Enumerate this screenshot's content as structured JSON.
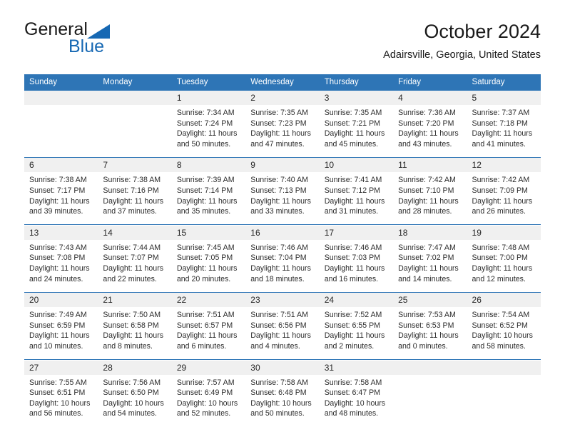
{
  "brand": {
    "name_part1": "General",
    "name_part2": "Blue",
    "triangle_color": "#1668b3",
    "blue_text_color": "#1668b3"
  },
  "header": {
    "title": "October 2024",
    "subtitle": "Adairsville, Georgia, United States"
  },
  "theme": {
    "header_blue": "#2e75b6",
    "daynum_band": "#f0f0f0",
    "text": "#2b2b2b"
  },
  "weekday_headers": [
    "Sunday",
    "Monday",
    "Tuesday",
    "Wednesday",
    "Thursday",
    "Friday",
    "Saturday"
  ],
  "weeks": [
    {
      "days": [
        {
          "num": "",
          "sunrise": "",
          "sunset": "",
          "daylight_line1": "",
          "daylight_line2": ""
        },
        {
          "num": "",
          "sunrise": "",
          "sunset": "",
          "daylight_line1": "",
          "daylight_line2": ""
        },
        {
          "num": "1",
          "sunrise": "Sunrise: 7:34 AM",
          "sunset": "Sunset: 7:24 PM",
          "daylight_line1": "Daylight: 11 hours",
          "daylight_line2": "and 50 minutes."
        },
        {
          "num": "2",
          "sunrise": "Sunrise: 7:35 AM",
          "sunset": "Sunset: 7:23 PM",
          "daylight_line1": "Daylight: 11 hours",
          "daylight_line2": "and 47 minutes."
        },
        {
          "num": "3",
          "sunrise": "Sunrise: 7:35 AM",
          "sunset": "Sunset: 7:21 PM",
          "daylight_line1": "Daylight: 11 hours",
          "daylight_line2": "and 45 minutes."
        },
        {
          "num": "4",
          "sunrise": "Sunrise: 7:36 AM",
          "sunset": "Sunset: 7:20 PM",
          "daylight_line1": "Daylight: 11 hours",
          "daylight_line2": "and 43 minutes."
        },
        {
          "num": "5",
          "sunrise": "Sunrise: 7:37 AM",
          "sunset": "Sunset: 7:18 PM",
          "daylight_line1": "Daylight: 11 hours",
          "daylight_line2": "and 41 minutes."
        }
      ]
    },
    {
      "days": [
        {
          "num": "6",
          "sunrise": "Sunrise: 7:38 AM",
          "sunset": "Sunset: 7:17 PM",
          "daylight_line1": "Daylight: 11 hours",
          "daylight_line2": "and 39 minutes."
        },
        {
          "num": "7",
          "sunrise": "Sunrise: 7:38 AM",
          "sunset": "Sunset: 7:16 PM",
          "daylight_line1": "Daylight: 11 hours",
          "daylight_line2": "and 37 minutes."
        },
        {
          "num": "8",
          "sunrise": "Sunrise: 7:39 AM",
          "sunset": "Sunset: 7:14 PM",
          "daylight_line1": "Daylight: 11 hours",
          "daylight_line2": "and 35 minutes."
        },
        {
          "num": "9",
          "sunrise": "Sunrise: 7:40 AM",
          "sunset": "Sunset: 7:13 PM",
          "daylight_line1": "Daylight: 11 hours",
          "daylight_line2": "and 33 minutes."
        },
        {
          "num": "10",
          "sunrise": "Sunrise: 7:41 AM",
          "sunset": "Sunset: 7:12 PM",
          "daylight_line1": "Daylight: 11 hours",
          "daylight_line2": "and 31 minutes."
        },
        {
          "num": "11",
          "sunrise": "Sunrise: 7:42 AM",
          "sunset": "Sunset: 7:10 PM",
          "daylight_line1": "Daylight: 11 hours",
          "daylight_line2": "and 28 minutes."
        },
        {
          "num": "12",
          "sunrise": "Sunrise: 7:42 AM",
          "sunset": "Sunset: 7:09 PM",
          "daylight_line1": "Daylight: 11 hours",
          "daylight_line2": "and 26 minutes."
        }
      ]
    },
    {
      "days": [
        {
          "num": "13",
          "sunrise": "Sunrise: 7:43 AM",
          "sunset": "Sunset: 7:08 PM",
          "daylight_line1": "Daylight: 11 hours",
          "daylight_line2": "and 24 minutes."
        },
        {
          "num": "14",
          "sunrise": "Sunrise: 7:44 AM",
          "sunset": "Sunset: 7:07 PM",
          "daylight_line1": "Daylight: 11 hours",
          "daylight_line2": "and 22 minutes."
        },
        {
          "num": "15",
          "sunrise": "Sunrise: 7:45 AM",
          "sunset": "Sunset: 7:05 PM",
          "daylight_line1": "Daylight: 11 hours",
          "daylight_line2": "and 20 minutes."
        },
        {
          "num": "16",
          "sunrise": "Sunrise: 7:46 AM",
          "sunset": "Sunset: 7:04 PM",
          "daylight_line1": "Daylight: 11 hours",
          "daylight_line2": "and 18 minutes."
        },
        {
          "num": "17",
          "sunrise": "Sunrise: 7:46 AM",
          "sunset": "Sunset: 7:03 PM",
          "daylight_line1": "Daylight: 11 hours",
          "daylight_line2": "and 16 minutes."
        },
        {
          "num": "18",
          "sunrise": "Sunrise: 7:47 AM",
          "sunset": "Sunset: 7:02 PM",
          "daylight_line1": "Daylight: 11 hours",
          "daylight_line2": "and 14 minutes."
        },
        {
          "num": "19",
          "sunrise": "Sunrise: 7:48 AM",
          "sunset": "Sunset: 7:00 PM",
          "daylight_line1": "Daylight: 11 hours",
          "daylight_line2": "and 12 minutes."
        }
      ]
    },
    {
      "days": [
        {
          "num": "20",
          "sunrise": "Sunrise: 7:49 AM",
          "sunset": "Sunset: 6:59 PM",
          "daylight_line1": "Daylight: 11 hours",
          "daylight_line2": "and 10 minutes."
        },
        {
          "num": "21",
          "sunrise": "Sunrise: 7:50 AM",
          "sunset": "Sunset: 6:58 PM",
          "daylight_line1": "Daylight: 11 hours",
          "daylight_line2": "and 8 minutes."
        },
        {
          "num": "22",
          "sunrise": "Sunrise: 7:51 AM",
          "sunset": "Sunset: 6:57 PM",
          "daylight_line1": "Daylight: 11 hours",
          "daylight_line2": "and 6 minutes."
        },
        {
          "num": "23",
          "sunrise": "Sunrise: 7:51 AM",
          "sunset": "Sunset: 6:56 PM",
          "daylight_line1": "Daylight: 11 hours",
          "daylight_line2": "and 4 minutes."
        },
        {
          "num": "24",
          "sunrise": "Sunrise: 7:52 AM",
          "sunset": "Sunset: 6:55 PM",
          "daylight_line1": "Daylight: 11 hours",
          "daylight_line2": "and 2 minutes."
        },
        {
          "num": "25",
          "sunrise": "Sunrise: 7:53 AM",
          "sunset": "Sunset: 6:53 PM",
          "daylight_line1": "Daylight: 11 hours",
          "daylight_line2": "and 0 minutes."
        },
        {
          "num": "26",
          "sunrise": "Sunrise: 7:54 AM",
          "sunset": "Sunset: 6:52 PM",
          "daylight_line1": "Daylight: 10 hours",
          "daylight_line2": "and 58 minutes."
        }
      ]
    },
    {
      "days": [
        {
          "num": "27",
          "sunrise": "Sunrise: 7:55 AM",
          "sunset": "Sunset: 6:51 PM",
          "daylight_line1": "Daylight: 10 hours",
          "daylight_line2": "and 56 minutes."
        },
        {
          "num": "28",
          "sunrise": "Sunrise: 7:56 AM",
          "sunset": "Sunset: 6:50 PM",
          "daylight_line1": "Daylight: 10 hours",
          "daylight_line2": "and 54 minutes."
        },
        {
          "num": "29",
          "sunrise": "Sunrise: 7:57 AM",
          "sunset": "Sunset: 6:49 PM",
          "daylight_line1": "Daylight: 10 hours",
          "daylight_line2": "and 52 minutes."
        },
        {
          "num": "30",
          "sunrise": "Sunrise: 7:58 AM",
          "sunset": "Sunset: 6:48 PM",
          "daylight_line1": "Daylight: 10 hours",
          "daylight_line2": "and 50 minutes."
        },
        {
          "num": "31",
          "sunrise": "Sunrise: 7:58 AM",
          "sunset": "Sunset: 6:47 PM",
          "daylight_line1": "Daylight: 10 hours",
          "daylight_line2": "and 48 minutes."
        },
        {
          "num": "",
          "sunrise": "",
          "sunset": "",
          "daylight_line1": "",
          "daylight_line2": ""
        },
        {
          "num": "",
          "sunrise": "",
          "sunset": "",
          "daylight_line1": "",
          "daylight_line2": ""
        }
      ]
    }
  ]
}
